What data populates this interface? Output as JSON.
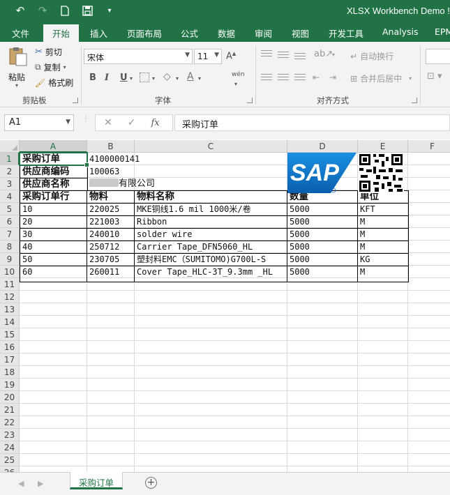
{
  "window": {
    "title": "XLSX Workbench Demo !"
  },
  "ribbon_tabs": [
    "文件",
    "开始",
    "插入",
    "页面布局",
    "公式",
    "数据",
    "审阅",
    "视图",
    "开发工具",
    "Analysis",
    "EPM"
  ],
  "clipboard": {
    "paste": "粘贴",
    "cut": "剪切",
    "copy": "复制",
    "format_painter": "格式刷",
    "group_label": "剪贴板"
  },
  "font": {
    "name": "宋体",
    "size": "11",
    "bold": "B",
    "italic": "I",
    "underline": "U",
    "wen": "wén",
    "group_label": "字体"
  },
  "alignment": {
    "wrap_text": "自动换行",
    "merge_center": "合并后居中",
    "group_label": "对齐方式"
  },
  "formula_bar": {
    "name_box": "A1",
    "fx": "fx",
    "value": "采购订单"
  },
  "columns": [
    "A",
    "B",
    "C",
    "D",
    "E",
    "F"
  ],
  "rows": [
    "1",
    "2",
    "3",
    "4",
    "5",
    "6",
    "7",
    "8",
    "9",
    "10",
    "11",
    "12",
    "13",
    "14",
    "15",
    "16",
    "17",
    "18",
    "19",
    "20",
    "21",
    "22",
    "23",
    "24",
    "25",
    "26"
  ],
  "header": {
    "po_label": "采购订单",
    "po_value": "4100000141",
    "vendor_code_label": "供应商编码",
    "vendor_code_value": "100063",
    "vendor_name_label": "供应商名称",
    "vendor_name_value": "有限公司"
  },
  "table": {
    "headers": [
      "采购订单行",
      "物料",
      "物料名称",
      "数量",
      "单位"
    ],
    "rows": [
      [
        "10",
        "220025",
        "MKE铜线1.6 mil 1000米/卷",
        "5000",
        "KFT"
      ],
      [
        "20",
        "221003",
        "Ribbon",
        "5000",
        "M"
      ],
      [
        "30",
        "240010",
        "solder wire",
        "5000",
        "M"
      ],
      [
        "40",
        "250712",
        "Carrier Tape_DFN5060_HL",
        "5000",
        "M"
      ],
      [
        "50",
        "230705",
        "塑封料EMC（SUMITOMO)G700L-S",
        "5000",
        "KG"
      ],
      [
        "60",
        "260011",
        "Cover Tape_HLC-3T_9.3mm _HL",
        "5000",
        "M"
      ]
    ]
  },
  "logo": {
    "text": "SAP",
    "color": "#0a6ed1"
  },
  "sheets": [
    "采购订单"
  ],
  "accent_color": "#217346"
}
